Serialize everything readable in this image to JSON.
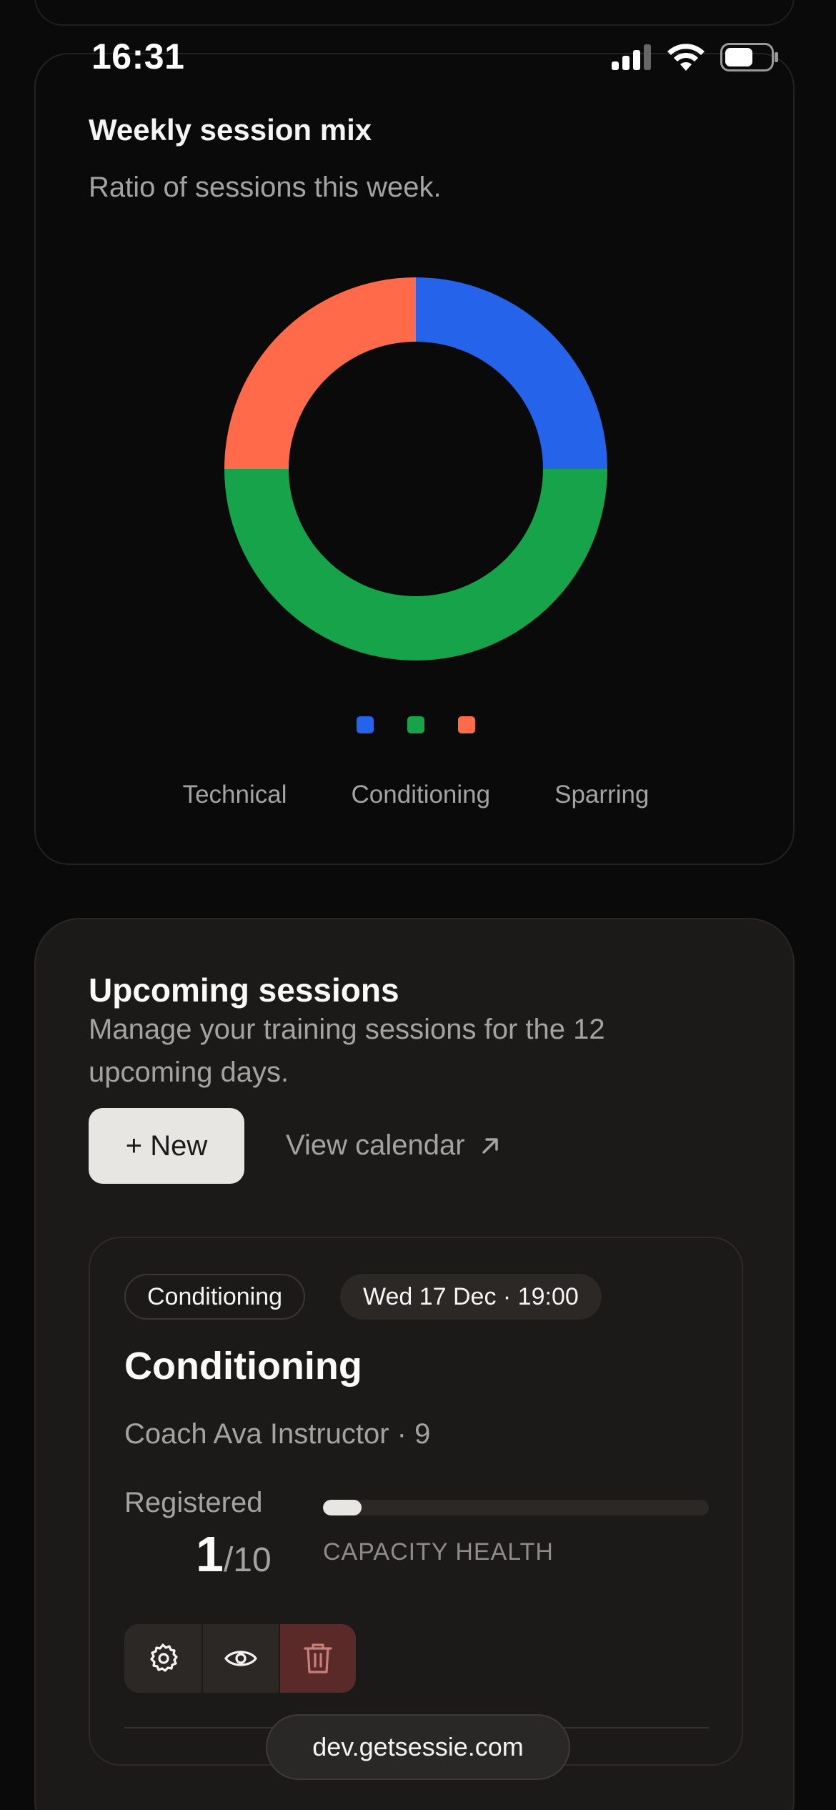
{
  "status_bar": {
    "time": "16:31"
  },
  "chart_card": {
    "title": "Weekly session mix",
    "subtitle": "Ratio of sessions this week."
  },
  "chart_data": {
    "type": "pie",
    "donut": true,
    "categories": [
      "Technical",
      "Conditioning",
      "Sparring"
    ],
    "values": [
      1,
      2,
      1
    ],
    "colors": [
      "#2563eb",
      "#16a34a",
      "#ff6b4a"
    ],
    "legend_placement": "bottom"
  },
  "upcoming": {
    "title": "Upcoming sessions",
    "description": "Manage your training sessions for the 12 upcoming days.",
    "new_label": "+ New",
    "view_calendar_label": "View calendar"
  },
  "session": {
    "type_chip": "Conditioning",
    "date_chip": "Wed 17 Dec · 19:00",
    "title": "Conditioning",
    "coach": "Coach Ava Instructor · 9",
    "registered_label": "Registered",
    "registered_count": "1",
    "capacity_total": "/10",
    "capacity_fraction": 0.1,
    "capacity_label": "CAPACITY HEALTH",
    "actions": [
      {
        "icon": "settings-gear-icon"
      },
      {
        "icon": "eye-icon"
      },
      {
        "icon": "trash-icon"
      }
    ]
  },
  "browser": {
    "url": "dev.getsessie.com"
  }
}
